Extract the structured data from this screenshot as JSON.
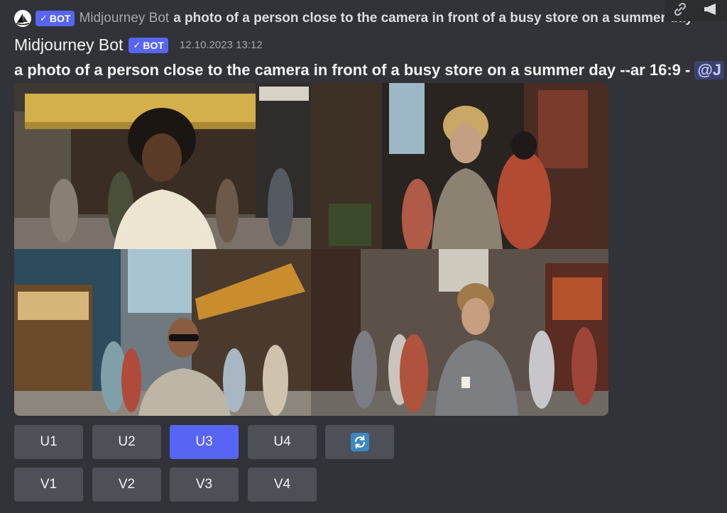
{
  "reply": {
    "bot_tag": "BOT",
    "author": "Midjourney Bot",
    "text": "a photo of a person close to the camera in front of a busy store on a summer day"
  },
  "message": {
    "author": "Midjourney Bot",
    "bot_tag": "BOT",
    "timestamp": "12.10.2023 13:12",
    "prompt": "a photo of a person close to the camera in front of a busy store on a summer day --ar 16:9 -",
    "mention": "@J"
  },
  "toolbar": {
    "icons": [
      "link-icon",
      "speaker-icon"
    ]
  },
  "image_grid": {
    "cells": [
      {
        "name": "image-1",
        "description_icon": "photo"
      },
      {
        "name": "image-2",
        "description_icon": "photo"
      },
      {
        "name": "image-3",
        "description_icon": "photo"
      },
      {
        "name": "image-4",
        "description_icon": "photo"
      }
    ]
  },
  "buttons": {
    "upscale": [
      "U1",
      "U2",
      "U3",
      "U4"
    ],
    "variation": [
      "V1",
      "V2",
      "V3",
      "V4"
    ],
    "active": "U3",
    "reroll_icon": "refresh-icon"
  },
  "colors": {
    "background": "#313338",
    "blurple": "#5865f2",
    "button": "#4e5058",
    "reroll": "#3b88c3"
  }
}
